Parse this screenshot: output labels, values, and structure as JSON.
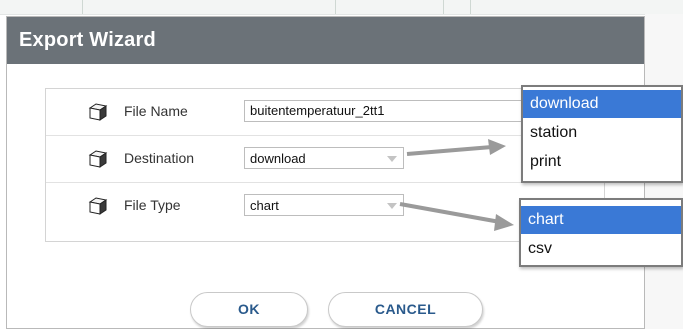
{
  "dialog": {
    "title": "Export Wizard"
  },
  "form": {
    "file_name": {
      "label": "File Name",
      "value": "buitentemperatuur_2tt1",
      "icon": "cube-icon"
    },
    "destination": {
      "label": "Destination",
      "value": "download",
      "icon": "cube-icon"
    },
    "file_type": {
      "label": "File Type",
      "value": "chart",
      "icon": "cube-icon"
    }
  },
  "buttons": {
    "ok": "OK",
    "cancel": "CANCEL"
  },
  "destination_options": [
    "download",
    "station",
    "print"
  ],
  "file_type_options": [
    "chart",
    "csv"
  ],
  "colors": {
    "header": "#6b7278",
    "selected": "#3a79d6",
    "button_text": "#2a5a8c"
  }
}
